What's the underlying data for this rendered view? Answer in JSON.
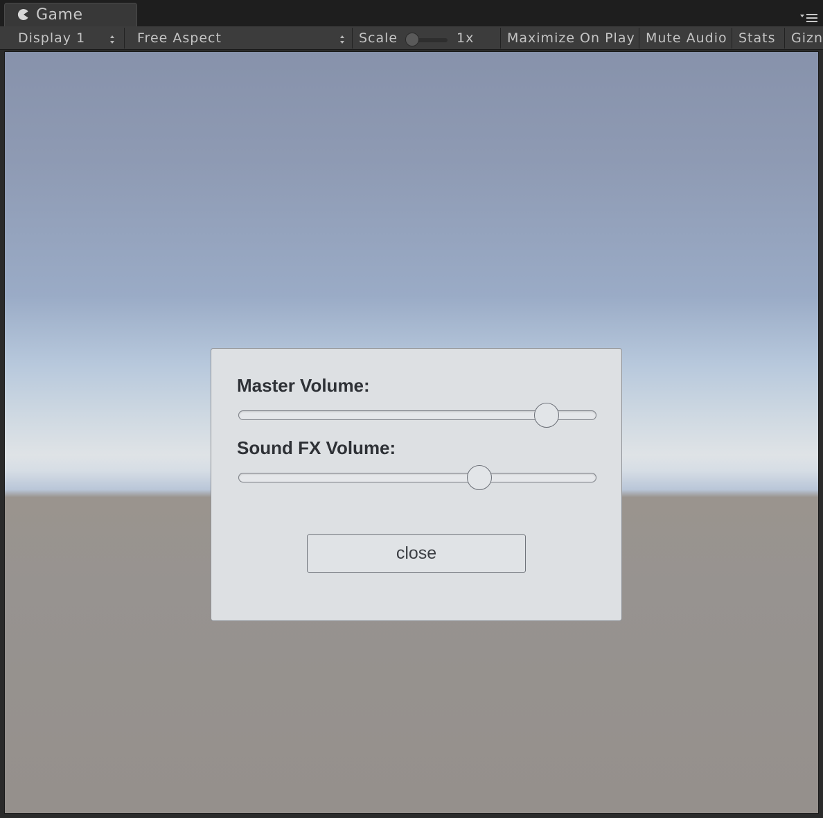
{
  "tab": {
    "label": "Game",
    "icon": "pacman-icon"
  },
  "toolbar": {
    "display": "Display 1",
    "aspect": "Free Aspect",
    "scale_label": "Scale",
    "scale_value": "1x",
    "scale_level": 0,
    "maximize": "Maximize On Play",
    "mute": "Mute Audio",
    "stats": "Stats",
    "gizmos": "Gizn"
  },
  "dialog": {
    "master_label": "Master Volume:",
    "master_value": 0.86,
    "sfx_label": "Sound FX Volume:",
    "sfx_value": 0.674,
    "close_label": "close"
  },
  "colors": {
    "toolbar_bg": "#3c3c3c",
    "dialog_bg": "#dde0e3",
    "ground": "#969290",
    "sky_top": "#8792ab"
  }
}
